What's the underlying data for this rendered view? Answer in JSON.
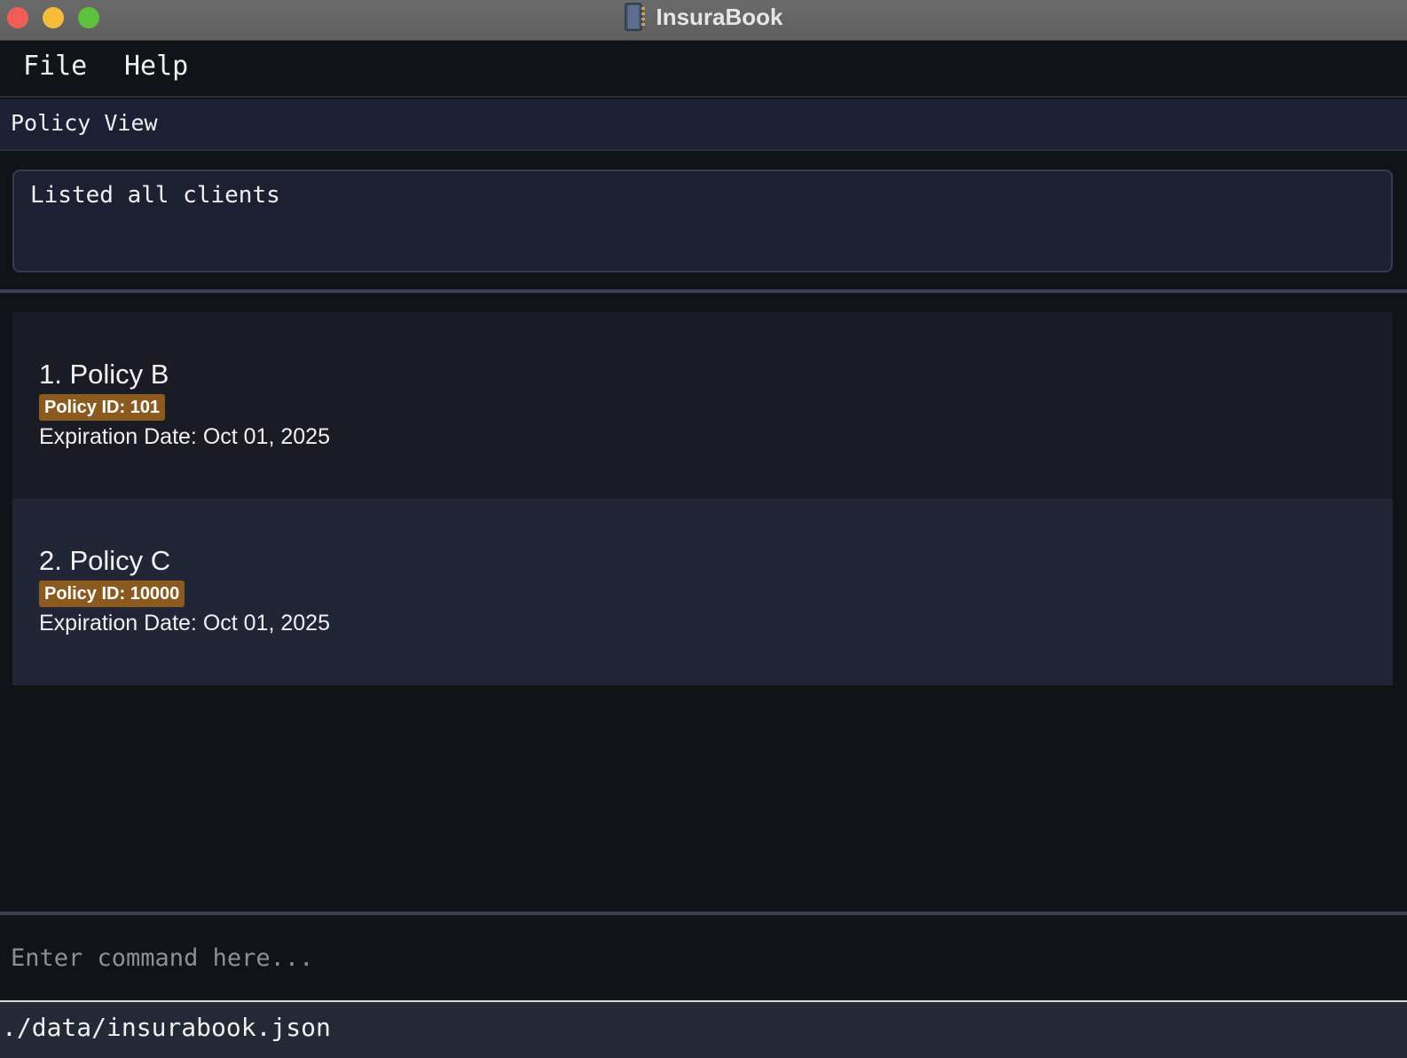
{
  "window": {
    "title": "InsuraBook",
    "icon": "book-icon",
    "controls": [
      "close",
      "minimize",
      "maximize"
    ]
  },
  "menu": {
    "items": [
      {
        "label": "File"
      },
      {
        "label": "Help"
      }
    ]
  },
  "view": {
    "title": "Policy View"
  },
  "result": {
    "message": "Listed all clients"
  },
  "policies": [
    {
      "title": "1. Policy B",
      "badge": "Policy ID: 101",
      "expiry": "Expiration Date: Oct 01, 2025"
    },
    {
      "title": "2. Policy C",
      "badge": "Policy ID: 10000",
      "expiry": "Expiration Date: Oct 01, 2025"
    }
  ],
  "command": {
    "placeholder": "Enter command here..."
  },
  "status": {
    "path": "./data/insurabook.json"
  },
  "colors": {
    "background": "#101418",
    "header": "#1c2034",
    "card_odd": "#1b1b26",
    "card_even": "#222536",
    "badge": "#8a5a1f",
    "status_bar": "#232a36"
  }
}
